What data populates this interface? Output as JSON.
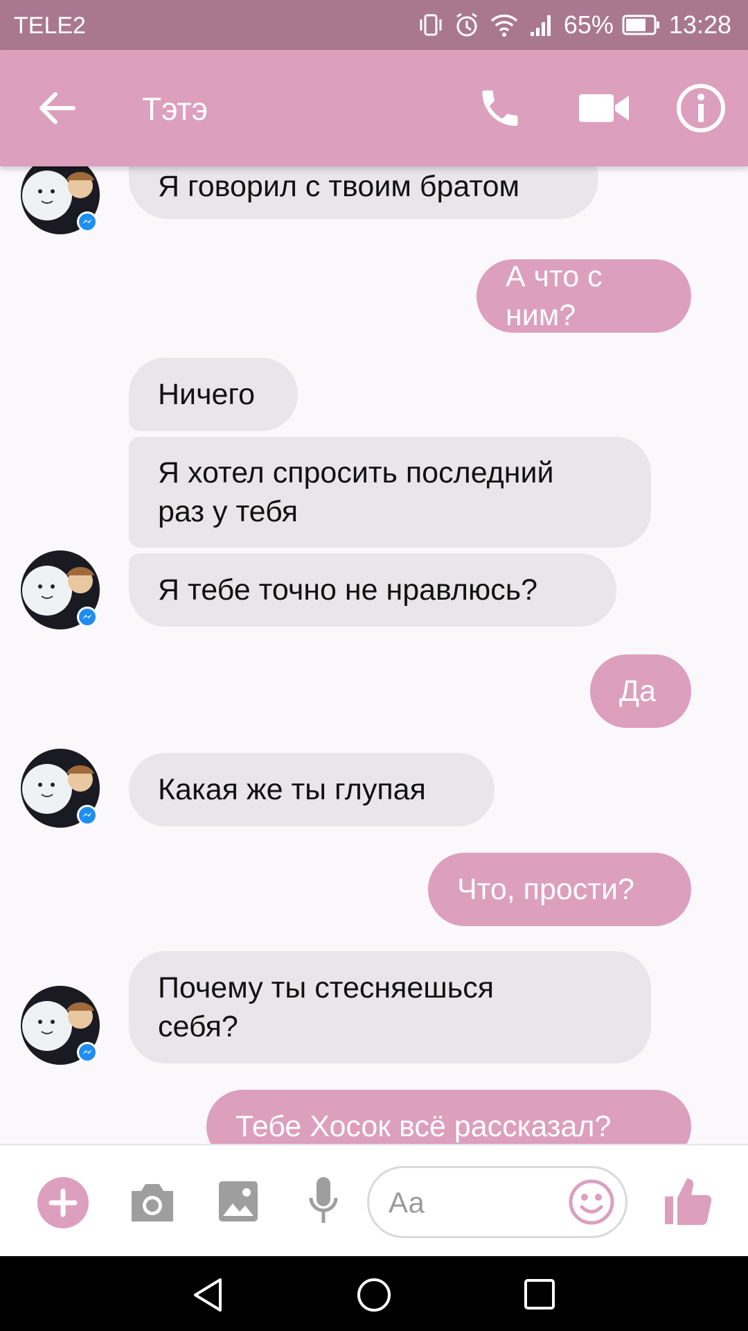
{
  "status_bar": {
    "carrier": "TELE2",
    "battery": "65%",
    "time": "13:28",
    "icons": [
      "vibrate-icon",
      "alarm-icon",
      "wifi-icon",
      "signal-icon",
      "battery-icon"
    ]
  },
  "header": {
    "contact_name": "Тэтэ",
    "icons": [
      "back-arrow-icon",
      "phone-icon",
      "video-camera-icon",
      "info-icon"
    ]
  },
  "messages": [
    {
      "from": "them",
      "text": "Я говорил с твоим братом"
    },
    {
      "from": "me",
      "text": "А что с ним?"
    },
    {
      "from": "them",
      "text": "Ничего"
    },
    {
      "from": "them",
      "text": "Я хотел спросить последний\nраз у тебя"
    },
    {
      "from": "them",
      "text": "Я тебе точно не нравлюсь?"
    },
    {
      "from": "me",
      "text": "Да"
    },
    {
      "from": "them",
      "text": "Какая же ты глупая"
    },
    {
      "from": "me",
      "text": "Что, прости?"
    },
    {
      "from": "them",
      "text": "Почему ты стесняешься\nсебя?"
    },
    {
      "from": "me",
      "text": "Тебе Хосок всё рассказал?"
    }
  ],
  "composer": {
    "placeholder": "Аа",
    "icons": [
      "plus-icon",
      "camera-icon",
      "gallery-icon",
      "microphone-icon",
      "emoji-icon",
      "thumbs-up-icon"
    ]
  },
  "colors": {
    "accent": "#dc9fbe",
    "status_bar": "#a9788f",
    "incoming_bubble": "#e8e6ea",
    "background": "#fbf8fc"
  }
}
